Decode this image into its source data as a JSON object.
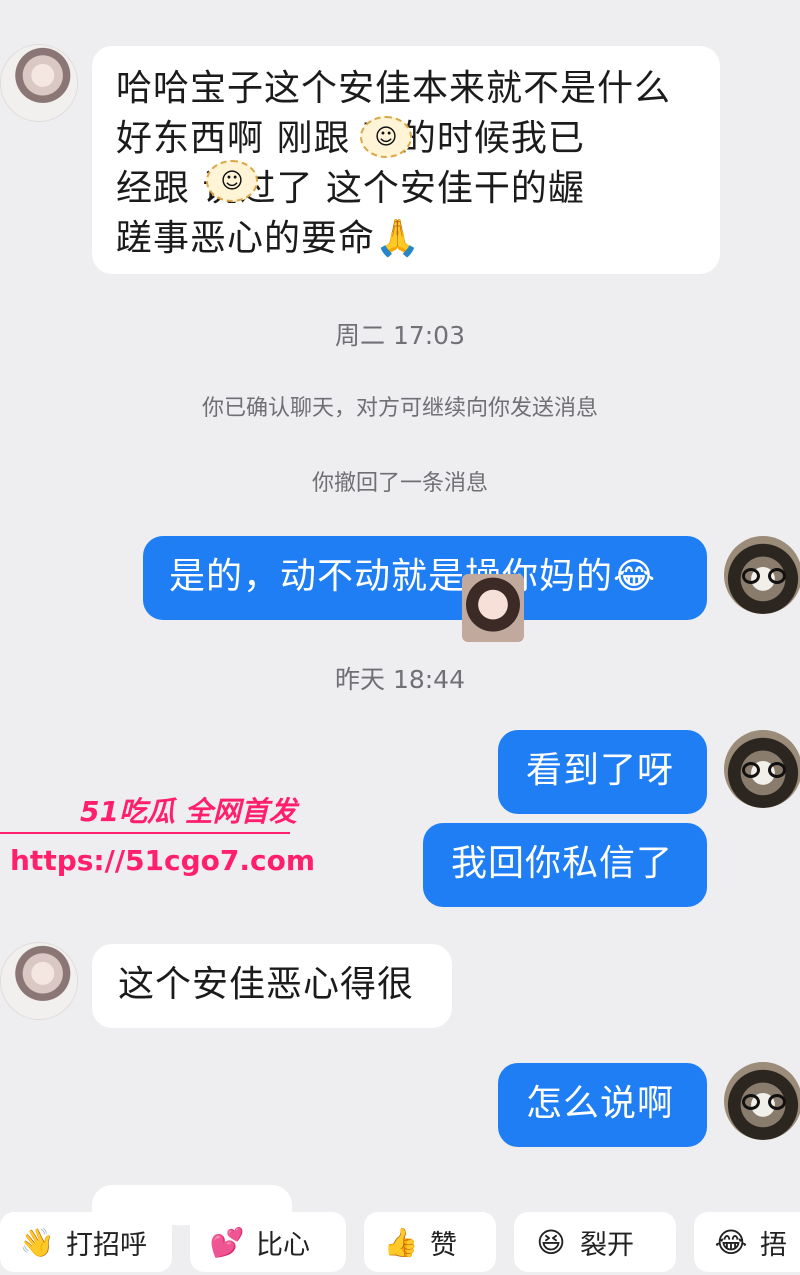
{
  "messages": {
    "m1_lines": [
      "哈哈宝子这个安佳本来就不是什么",
      "好东西啊 刚跟 玩的时候我已",
      "经跟 说过了 这个安佳干的龌",
      "蹉事恶心的要命🙏"
    ],
    "time1": "周二 17:03",
    "sys1": "你已确认聊天，对方可继续向你发送消息",
    "sys2": "你撤回了一条消息",
    "m2": "是的，动不动就是操你妈的",
    "m2_emoji": "😂",
    "time2": "昨天 18:44",
    "m3": "看到了呀",
    "m4": "我回你私信了",
    "m5": "这个安佳恶心得很",
    "m6": "怎么说啊"
  },
  "watermark": {
    "brand": "51吃瓜 全网首发",
    "url": "https://51cgo7.com"
  },
  "quick_replies": [
    {
      "emoji": "👋",
      "label": "打招呼"
    },
    {
      "emoji": "💕",
      "label": "比心"
    },
    {
      "emoji": "👍",
      "label": "赞"
    },
    {
      "emoji": "😆",
      "label": "裂开"
    },
    {
      "emoji": "😂",
      "label": "捂"
    }
  ],
  "colors": {
    "outgoing_bubble": "#1f7ef3",
    "incoming_bubble": "#ffffff",
    "background": "#eeeef0",
    "watermark": "#ff1f6a"
  }
}
